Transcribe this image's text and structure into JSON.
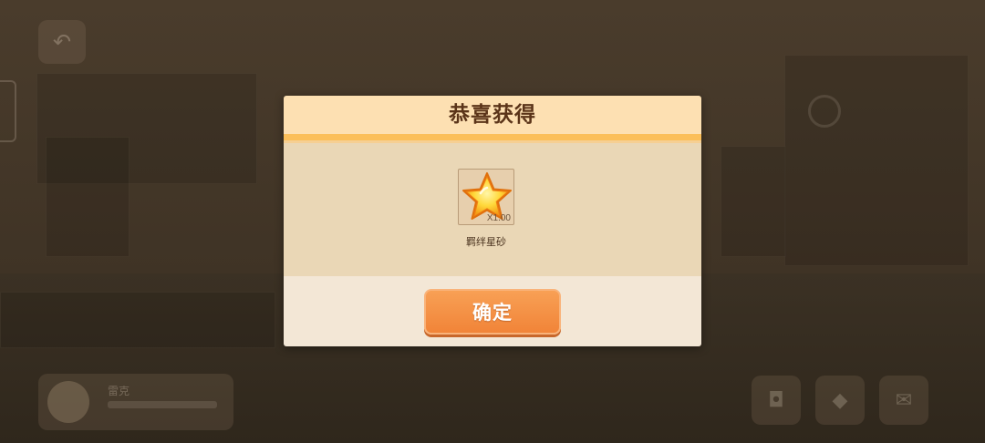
{
  "dialog": {
    "title": "恭喜获得",
    "reward": {
      "icon": "star-icon",
      "quantity": "X1.00",
      "name": "羁绊星砂"
    },
    "confirm_label": "确定"
  },
  "background": {
    "back_icon": "back-arrow-icon",
    "character_name": "雷克",
    "item_icons": [
      "gift-icon",
      "gold-icon",
      "mail-icon"
    ]
  },
  "colors": {
    "header": "#fde0b2",
    "header_stripe": "#fbbf5a",
    "content": "#ead7b6",
    "footer": "#f3e7d6",
    "button": "#f18438",
    "title_text": "#5b3419"
  }
}
